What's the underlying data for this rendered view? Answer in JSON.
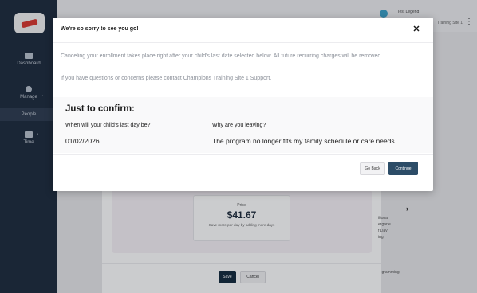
{
  "sidebar": {
    "items": [
      {
        "label": "Dashboard",
        "icon": "dashboard-icon"
      },
      {
        "label": "Manage",
        "icon": "manage-icon"
      },
      {
        "label": "People",
        "icon": "people-icon"
      },
      {
        "label": "Time",
        "icon": "calendar-icon"
      }
    ]
  },
  "header": {
    "user_name": "Test Legend",
    "site_name": "Training Site 1"
  },
  "background": {
    "price_label": "Price",
    "price_value": "$41.67",
    "price_note": "Save more per day by adding more days",
    "right_snippet": [
      "itional",
      "ergarte",
      "f Day",
      "ing"
    ],
    "right_programming": "rogramming.",
    "save_label": "Save",
    "cancel_label": "Cancel"
  },
  "modal": {
    "title": "We're so sorry to see you go!",
    "message1": "Canceling your enrollment takes place right after your child's last date selected below. All future recurring charges will be removed.",
    "message2": "If you have questions or concerns please contact Champions Training Site 1 Support.",
    "confirm_heading": "Just to confirm:",
    "last_day_label": "When will your child's last day be?",
    "last_day_value": "01/02/2026",
    "reason_label": "Why are you leaving?",
    "reason_value": "The program no longer fits my family schedule or care needs",
    "go_back_label": "Go Back",
    "continue_label": "Continue"
  },
  "colors": {
    "sidebar": "#1d2b3d",
    "primary_button": "#2c4c67",
    "save_button": "#13293d"
  }
}
